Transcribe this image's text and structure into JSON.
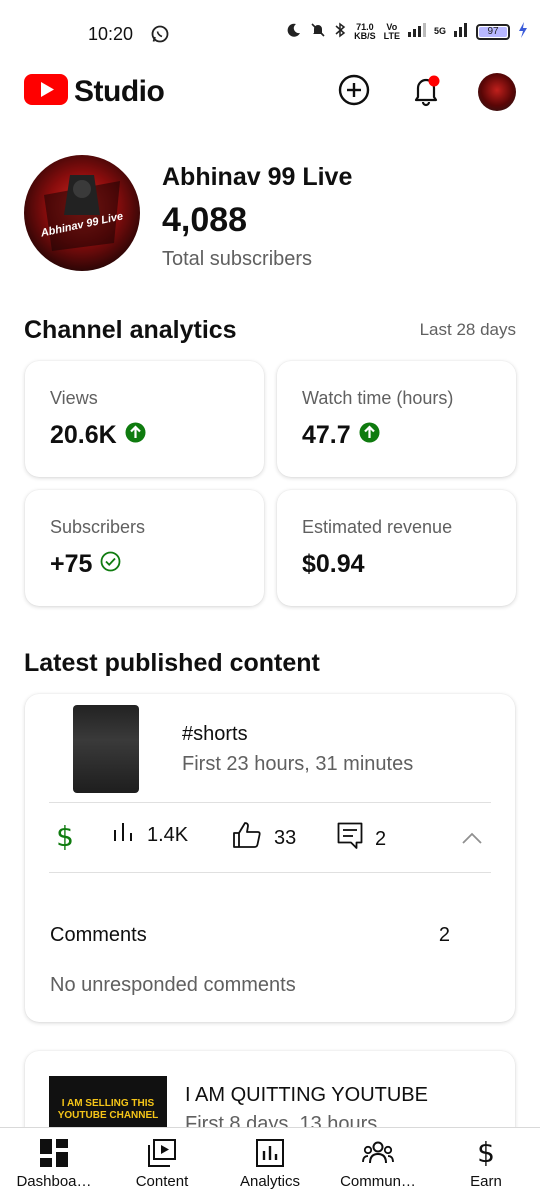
{
  "status_bar": {
    "time": "10:20",
    "net_speed_value": "71.0",
    "net_speed_unit": "KB/S",
    "volte_top": "Vo",
    "volte_bottom": "LTE",
    "network": "5G",
    "battery": "97"
  },
  "header": {
    "app_name": "Studio"
  },
  "channel": {
    "name": "Abhinav 99 Live",
    "subscriber_count": "4,088",
    "subscriber_label": "Total subscribers",
    "avatar_text": "Abhinav 99 Live"
  },
  "analytics": {
    "title": "Channel analytics",
    "range": "Last 28 days",
    "cards": [
      {
        "label": "Views",
        "value": "20.6K"
      },
      {
        "label": "Watch time (hours)",
        "value": "47.7"
      },
      {
        "label": "Subscribers",
        "value": "+75"
      },
      {
        "label": "Estimated revenue",
        "value": "$0.94"
      }
    ]
  },
  "latest": {
    "title": "Latest published content",
    "video": {
      "title": "#shorts",
      "subtitle": "First 23 hours, 31 minutes",
      "views": "1.4K",
      "likes": "33",
      "comments": "2",
      "comments_label": "Comments",
      "comments_count": "2",
      "no_responded": "No unresponded comments"
    },
    "video2": {
      "thumb_text": "I AM SELLING THIS YOUTUBE CHANNEL",
      "title": "I AM QUITTING YOUTUBE",
      "subtitle": "First 8 days, 13 hours"
    }
  },
  "nav": [
    {
      "label": "Dashboa…"
    },
    {
      "label": "Content"
    },
    {
      "label": "Analytics"
    },
    {
      "label": "Commun…"
    },
    {
      "label": "Earn"
    }
  ],
  "colors": {
    "brand_red": "#ff0000",
    "up_green": "#0f7b0f",
    "text_secondary": "#606060"
  }
}
